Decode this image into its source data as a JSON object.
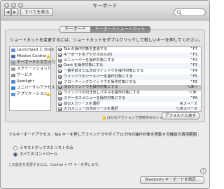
{
  "window": {
    "title": "キーボード"
  },
  "toolbar": {
    "back": "◀",
    "forward": "▶",
    "show_all": "すべてを表示"
  },
  "tabs": [
    {
      "label": "キーボード",
      "selected": false
    },
    {
      "label": "キーボードショートカット",
      "selected": true
    }
  ],
  "panel": {
    "instruction": "ショートカットを変更するには、ショートカットをダブルクリックして新しいキーを押してください。",
    "categories": [
      {
        "label": "Launchpad と Dock",
        "icon": "launchpad-icon",
        "color": "#6b8fc9",
        "warning": false
      },
      {
        "label": "Mission Control",
        "icon": "mission-control-icon",
        "color": "#4a6fa8",
        "warning": true
      },
      {
        "label": "キーボードと文字入力",
        "icon": "keyboard-icon",
        "color": "#9aa3ad",
        "warning": false,
        "selected": true
      },
      {
        "label": "スクリーンショット",
        "icon": "screenshot-icon",
        "color": "#a0a0a0",
        "warning": false
      },
      {
        "label": "サービス",
        "icon": "services-icon",
        "color": "#8a8f96",
        "warning": false
      },
      {
        "label": "Spotlight",
        "icon": "spotlight-icon",
        "color": "#5a87c6",
        "warning": false
      },
      {
        "label": "ユニバーサルアクセス",
        "icon": "accessibility-icon",
        "color": "#3d7ed0",
        "warning": false
      },
      {
        "label": "アプリケーション",
        "icon": "applications-icon",
        "color": "#5f95cf",
        "warning": true
      }
    ],
    "shortcuts": [
      {
        "label": "Tab の操作対象を変更する",
        "key": "^F7",
        "checked": true
      },
      {
        "label": "キーボードをアクセスの入/切",
        "key": "^F1",
        "checked": true
      },
      {
        "label": "メニューバーを操作対象にする",
        "key": "^F2",
        "checked": true
      },
      {
        "label": "Dock を操作対象にする",
        "key": "^F3",
        "checked": true
      },
      {
        "label": "一番手前または次のウインドウを操作対象にする",
        "key": "^F4",
        "checked": true
      },
      {
        "label": "ウインドウのツールバーを操作対象にする",
        "key": "^F5",
        "checked": true
      },
      {
        "label": "フローティングウインドウを操作対象にする",
        "key": "^F6",
        "checked": true
      },
      {
        "label": "次のウインドウを操作対象にする",
        "key": "⌥⌘→",
        "checked": true,
        "selected": true
      },
      {
        "label": "ウインドウの引き出しパネルを操作対象にする",
        "key": "⌥⌘'",
        "checked": true
      },
      {
        "label": "ステータスメニューを操作対象にする",
        "key": "^F8",
        "checked": true
      },
      {
        "label": "前の入力ソースを選択",
        "key": "⌘スペース",
        "checked": true
      },
      {
        "label": "入力メニューの次のソースを選択",
        "key": "⌥⌘スペース",
        "checked": true
      }
    ],
    "conflict_note": "ほかのアクションで使用済みのショートカット",
    "restore_defaults": "デフォルトに戻す"
  },
  "full_keyboard_access": {
    "label": "フルキーボードアクセス : Tab キーを押してウインドウやダイアログ内の操作対象を移動する機能の適用範囲 :",
    "options": [
      {
        "label": "テキストボックスとリストのみ",
        "selected": false
      },
      {
        "label": "すべてのコントロール",
        "selected": true
      }
    ],
    "hint": "この設定を変更するには、Control + F7 キーを押します。"
  },
  "footer": {
    "bluetooth_button": "Bluetooth キーボードを設定...",
    "help": "?"
  },
  "colors": {
    "warning": "#e8c21c",
    "selected_row": "#c8c8c8",
    "selected_tab": "#808080"
  }
}
